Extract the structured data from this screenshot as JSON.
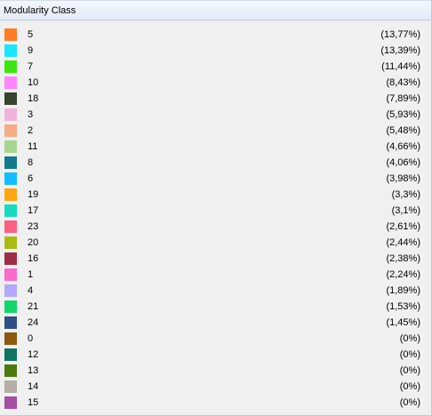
{
  "header": {
    "title": "Modularity Class"
  },
  "items": [
    {
      "label": "5",
      "percent": "(13,77%)",
      "color": "#ff7b24"
    },
    {
      "label": "9",
      "percent": "(13,39%)",
      "color": "#19e6ff"
    },
    {
      "label": "7",
      "percent": "(11,44%)",
      "color": "#3ee60f"
    },
    {
      "label": "10",
      "percent": "(8,43%)",
      "color": "#ff85ff"
    },
    {
      "label": "18",
      "percent": "(7,89%)",
      "color": "#3a4330"
    },
    {
      "label": "3",
      "percent": "(5,93%)",
      "color": "#f1b3dc"
    },
    {
      "label": "2",
      "percent": "(5,48%)",
      "color": "#f7ab86"
    },
    {
      "label": "11",
      "percent": "(4,66%)",
      "color": "#a6d68e"
    },
    {
      "label": "8",
      "percent": "(4,06%)",
      "color": "#137a8e"
    },
    {
      "label": "6",
      "percent": "(3,98%)",
      "color": "#12bdff"
    },
    {
      "label": "19",
      "percent": "(3,3%)",
      "color": "#ffa510"
    },
    {
      "label": "17",
      "percent": "(3,1%)",
      "color": "#19d9c0"
    },
    {
      "label": "23",
      "percent": "(2,61%)",
      "color": "#fc5f83"
    },
    {
      "label": "20",
      "percent": "(2,44%)",
      "color": "#acbb12"
    },
    {
      "label": "16",
      "percent": "(2,38%)",
      "color": "#9e2e44"
    },
    {
      "label": "1",
      "percent": "(2,24%)",
      "color": "#fa6cc9"
    },
    {
      "label": "4",
      "percent": "(1,89%)",
      "color": "#b3a7ff"
    },
    {
      "label": "21",
      "percent": "(1,53%)",
      "color": "#12d66a"
    },
    {
      "label": "24",
      "percent": "(1,45%)",
      "color": "#2f4e87"
    },
    {
      "label": "0",
      "percent": "(0%)",
      "color": "#8c5a0e"
    },
    {
      "label": "12",
      "percent": "(0%)",
      "color": "#0e7562"
    },
    {
      "label": "13",
      "percent": "(0%)",
      "color": "#4c7a0c"
    },
    {
      "label": "14",
      "percent": "(0%)",
      "color": "#b5aea4"
    },
    {
      "label": "15",
      "percent": "(0%)",
      "color": "#a64fa6"
    }
  ]
}
